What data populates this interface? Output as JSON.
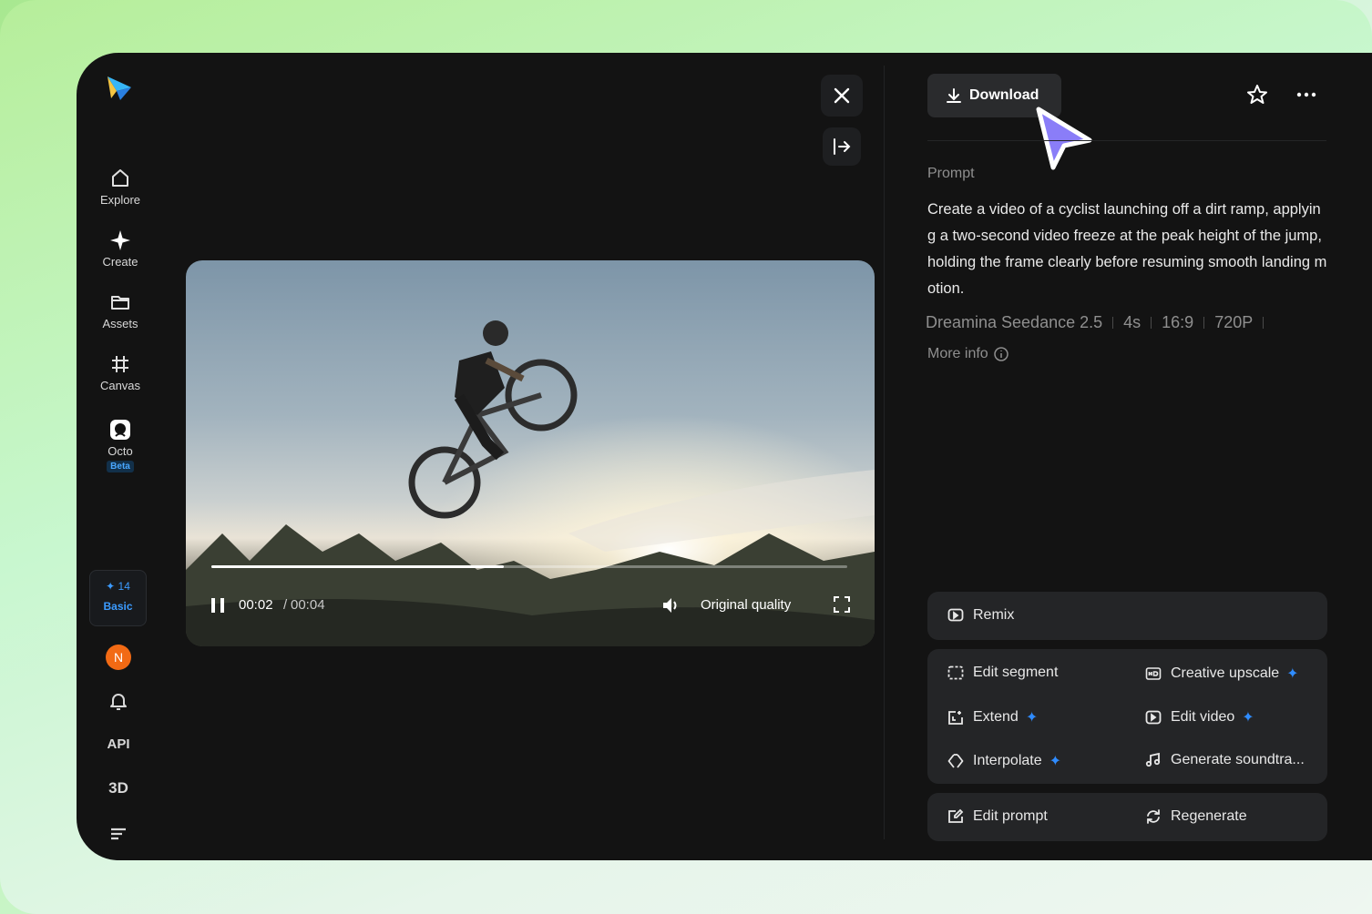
{
  "sidebar": {
    "items": [
      {
        "label": "Explore",
        "icon": "home-icon"
      },
      {
        "label": "Create",
        "icon": "sparkle-icon"
      },
      {
        "label": "Assets",
        "icon": "folder-icon"
      },
      {
        "label": "Canvas",
        "icon": "hash-frame-icon"
      },
      {
        "label": "Octo",
        "icon": "octo-icon",
        "badge": "Beta"
      }
    ],
    "credits": {
      "count": "14",
      "plan": "Basic"
    },
    "avatar_initial": "N",
    "api_label": "API",
    "three_d_label": "3D"
  },
  "player": {
    "current_time": "00:02",
    "separator": "/",
    "total_time": "00:04",
    "progress_fraction": 0.46,
    "quality_label": "Original quality"
  },
  "panel": {
    "download_label": "Download",
    "prompt_label": "Prompt",
    "prompt_text": "Create a video of a cyclist launching off a dirt ramp, applying a two-second video freeze at the peak height of the jump, holding the frame clearly before resuming smooth landing motion.",
    "meta": [
      "Dreamina Seedance 2.5",
      "4s",
      "16:9",
      "720P"
    ],
    "more_info_label": "More info",
    "actions": {
      "remix": "Remix",
      "edit_segment": "Edit segment",
      "creative_upscale": "Creative upscale",
      "extend": "Extend",
      "edit_video": "Edit video",
      "interpolate": "Interpolate",
      "generate_soundtrack": "Generate soundtra...",
      "edit_prompt": "Edit prompt",
      "regenerate": "Regenerate"
    }
  },
  "colors": {
    "accent": "#2f8cff",
    "cursor": "#7b6cf6",
    "avatar": "#f26a14",
    "app_bg": "#131313"
  }
}
